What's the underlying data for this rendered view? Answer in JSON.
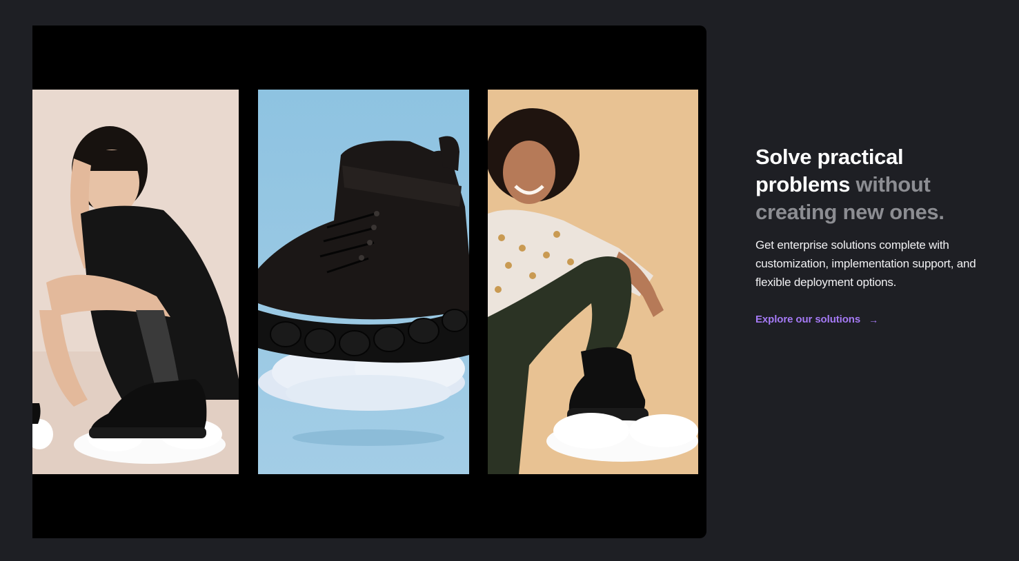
{
  "hero": {
    "headline_strong": "Solve practical problems",
    "headline_muted": "without creating new ones.",
    "description": "Get enterprise solutions complete with customization, implementation support, and flexible deployment options.",
    "cta_label": "Explore our solutions",
    "cta_icon": "arrow-right-icon"
  },
  "gallery": {
    "panels": [
      {
        "subject": "woman-crouching-with-black-boots",
        "background": "#e8d8cf"
      },
      {
        "subject": "black-boot-on-cloud",
        "background": "#8cbfdc"
      },
      {
        "subject": "woman-smiling-with-black-boot",
        "background": "#e7c08f"
      }
    ]
  },
  "colors": {
    "page_background": "#1e1f24",
    "card_background": "#000000",
    "headline": "#ffffff",
    "headline_muted": "#8c8d92",
    "accent": "#a57af5"
  }
}
